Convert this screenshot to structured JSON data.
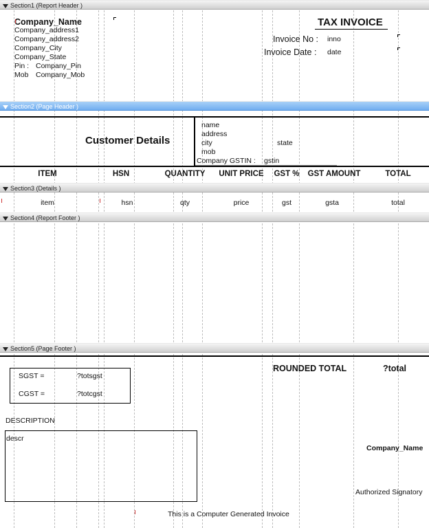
{
  "sections": {
    "s1": "Section1 (Report Header )",
    "s2": "Section2 (Page Header )",
    "s3": "Section3 (Details )",
    "s4": "Section4 (Report Footer )",
    "s5": "Section5 (Page Footer )"
  },
  "header": {
    "company_name": "Company_Name",
    "address1": "Company_address1",
    "address2": "Company_address2",
    "city": "Company_City",
    "state": "Company_State",
    "pin_label": "Pin :",
    "pin_value": "Company_Pin",
    "mob_label": "Mob",
    "mob_value": "Company_Mob",
    "title": "TAX INVOICE",
    "invoice_no_label": "Invoice No :",
    "invoice_no_value": "inno",
    "invoice_date_label": "Invoice Date :",
    "invoice_date_value": "date"
  },
  "page_header": {
    "customer_details": "Customer Details",
    "name": "name",
    "address": "address",
    "city": "city",
    "state": "state",
    "mob": "mob",
    "gstin_label": "Company GSTIN :",
    "gstin_value": "gstin",
    "columns": [
      "ITEM",
      "HSN",
      "QUANTITY",
      "UNIT PRICE",
      "GST %",
      "GST AMOUNT",
      "TOTAL"
    ]
  },
  "details": {
    "fields": [
      "item",
      "hsn",
      "qty",
      "price",
      "gst",
      "gsta",
      "total"
    ]
  },
  "footer": {
    "sgst_label": "SGST =",
    "sgst_value": "?totsgst",
    "cgst_label": "CGST =",
    "cgst_value": "?totcgst",
    "rounded_total_label": "ROUNDED TOTAL",
    "rounded_total_value": "?total",
    "description_label": "DESCRIPTION",
    "description_value": "descr",
    "company_name": "Company_Name",
    "authorized": "Authorized Signatory",
    "note": "This is a Computer Generated Invoice"
  }
}
